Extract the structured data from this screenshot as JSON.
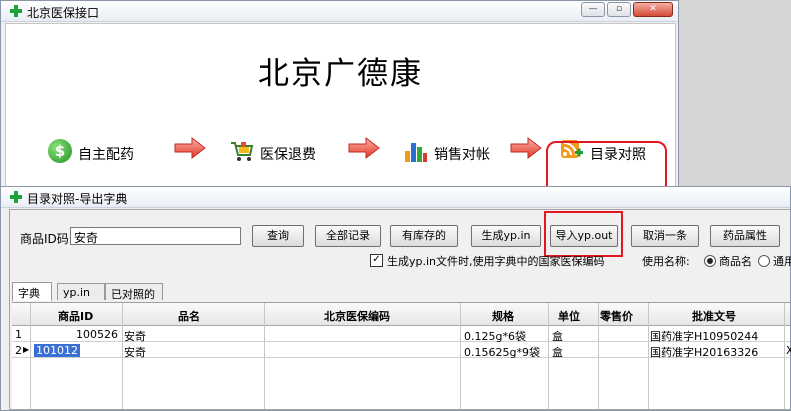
{
  "main_window": {
    "title": "北京医保接口",
    "heading": "北京广德康",
    "flow": [
      {
        "label": "自主配药",
        "icon": "dollar-coin-icon"
      },
      {
        "label": "医保退费",
        "icon": "shopping-cart-icon"
      },
      {
        "label": "销售对帐",
        "icon": "bar-chart-icon"
      },
      {
        "label": "目录对照",
        "icon": "rss-feed-add-icon"
      }
    ]
  },
  "dialog": {
    "title": "目录对照-导出字典",
    "search_label": "商品ID码",
    "search_value": "安奇",
    "buttons": {
      "query": "查询",
      "all_records": "全部记录",
      "in_stock": "有库存的",
      "generate": "生成yp.in",
      "import": "导入yp.out",
      "cancel_one": "取消一条",
      "drug_attr": "药品属性"
    },
    "option_text": "生成yp.in文件时,使用字典中的国家医保编码",
    "use_name_label": "使用名称:",
    "radio_options": [
      "商品名",
      "通用"
    ],
    "tabs": [
      "字典",
      "yp.in",
      "已对照的"
    ],
    "columns": [
      "商品ID",
      "品名",
      "北京医保编码",
      "规格",
      "单位",
      "零售价",
      "批准文号"
    ],
    "rows": [
      {
        "num": "1",
        "id": "100526",
        "name": "安奇",
        "code": "",
        "spec": "0.125g*6袋",
        "unit": "盒",
        "price": "",
        "approval": "国药准字H10950244"
      },
      {
        "num": "2",
        "id": "101012",
        "name": "安奇",
        "code": "",
        "spec": "0.15625g*9袋",
        "unit": "盒",
        "price": "",
        "approval": "国药准字H20163326"
      }
    ],
    "row2_extra": "X"
  }
}
